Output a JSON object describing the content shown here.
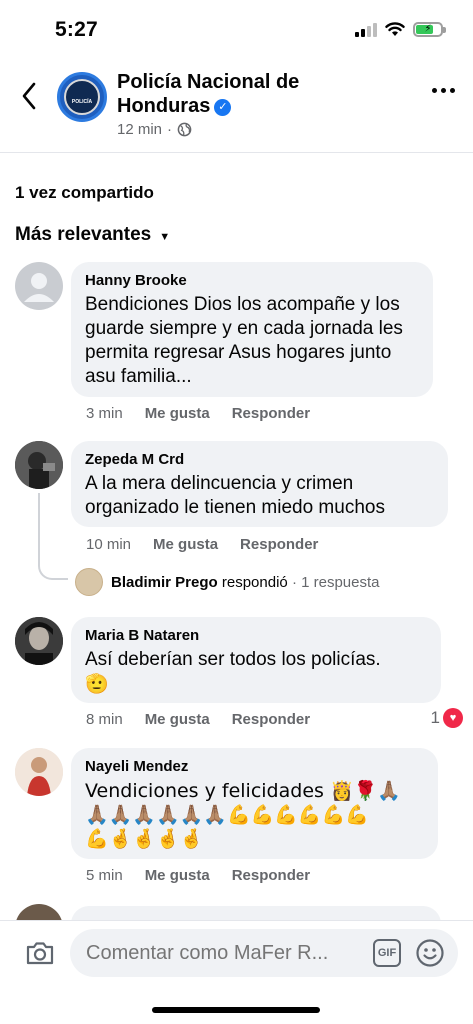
{
  "status_bar": {
    "time": "5:27"
  },
  "header": {
    "page_name": "Policía Nacional de Honduras",
    "post_age": "12 min",
    "avatar_label": "POLICÍA"
  },
  "shares": "1 vez compartido",
  "sort_label": "Más relevantes",
  "comments": [
    {
      "author": "Hanny Brooke",
      "text": "Bendiciones Dios los acompañe y los guarde siempre y en cada jornada les permita regresar Asus hogares junto asu familia...",
      "time": "3 min",
      "like": "Me gusta",
      "reply": "Responder"
    },
    {
      "author": "Zepeda M Crd",
      "text": "A la mera delincuencia y crimen organizado le tienen miedo muchos",
      "time": "10 min",
      "like": "Me gusta",
      "reply": "Responder",
      "reply_summary": {
        "author": "Bladimir Prego",
        "verb": "respondió",
        "count": "· 1 respuesta"
      }
    },
    {
      "author": "Maria B Nataren",
      "text": "Así deberían ser todos los policías.",
      "emoji": "🫡",
      "time": "8 min",
      "like": "Me gusta",
      "reply": "Responder",
      "reaction_count": "1"
    },
    {
      "author": "Nayeli Mendez",
      "text": "Vendiciones y felicidades 👸🌹🙏🏽",
      "emoji_line1": "🙏🏽🙏🏽🙏🏽🙏🏽🙏🏽🙏🏽💪💪💪💪💪💪",
      "emoji_line2": "💪🤞🤞🤞🤞",
      "time": "5 min",
      "like": "Me gusta",
      "reply": "Responder"
    }
  ],
  "composer": {
    "placeholder": "Comentar como MaFer R...",
    "gif_label": "GIF"
  },
  "colors": {
    "accent": "#1877f2",
    "bubble": "#f0f2f5",
    "meta_gray": "#65676b",
    "heart": "#f02849"
  }
}
